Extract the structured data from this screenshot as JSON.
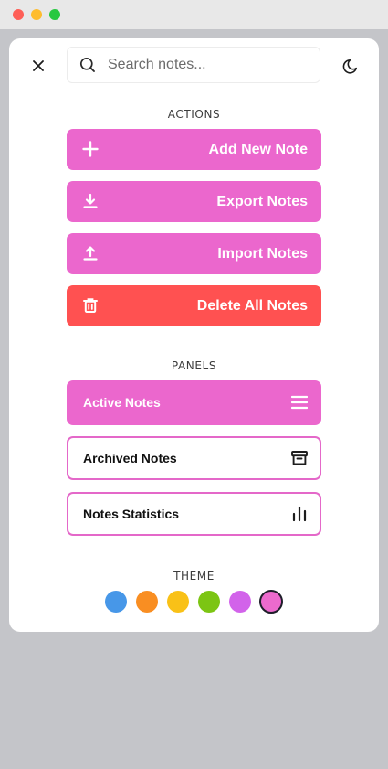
{
  "window": {
    "colors": {
      "close": "#fe5f57",
      "minimize": "#febc2e",
      "maximize": "#28c840"
    }
  },
  "header": {
    "close_icon": "close-icon",
    "search": {
      "placeholder": "Search notes...",
      "value": "",
      "icon": "search-icon"
    },
    "theme_toggle_icon": "moon-icon"
  },
  "actions": {
    "title": "ACTIONS",
    "items": [
      {
        "label": "Add New Note",
        "icon": "plus-icon",
        "color": "#eb67cd"
      },
      {
        "label": "Export Notes",
        "icon": "download-icon",
        "color": "#eb67cd"
      },
      {
        "label": "Import Notes",
        "icon": "upload-icon",
        "color": "#eb67cd"
      },
      {
        "label": "Delete All Notes",
        "icon": "trash-icon",
        "color": "#ff5151"
      }
    ]
  },
  "panels": {
    "title": "PANELS",
    "items": [
      {
        "label": "Active Notes",
        "icon": "list-icon",
        "active": true
      },
      {
        "label": "Archived Notes",
        "icon": "archive-icon",
        "active": false
      },
      {
        "label": "Notes Statistics",
        "icon": "bar-chart-icon",
        "active": false
      }
    ]
  },
  "theme": {
    "title": "THEME",
    "swatches": [
      {
        "name": "blue",
        "color": "#4797e8"
      },
      {
        "name": "orange",
        "color": "#f98e22"
      },
      {
        "name": "yellow",
        "color": "#f9c117"
      },
      {
        "name": "green",
        "color": "#7cc513"
      },
      {
        "name": "purple",
        "color": "#d263ea"
      },
      {
        "name": "pink",
        "color": "#ec6acd",
        "selected": true
      }
    ]
  }
}
